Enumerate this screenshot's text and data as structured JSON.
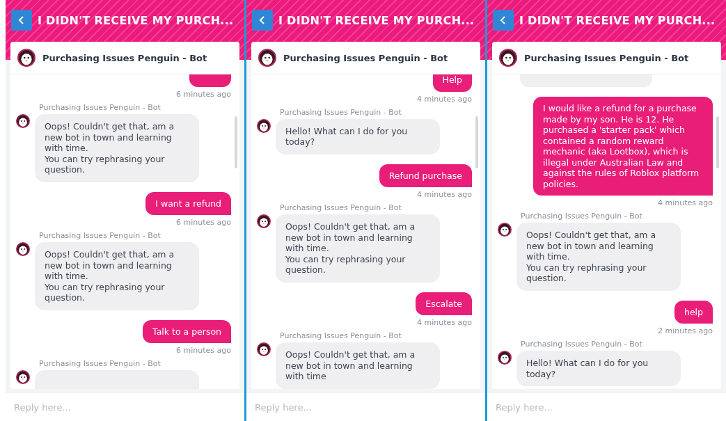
{
  "panels": [
    {
      "title": "I DIDN'T RECEIVE MY PURCH...",
      "bot_name": "Purchasing Issues Penguin - Bot",
      "reply_placeholder": "Reply here...",
      "messages": [
        {
          "kind": "user-cut",
          "time": "6 minutes ago"
        },
        {
          "kind": "bot",
          "sender": "Purchasing Issues Penguin - Bot",
          "text": "Oops! Couldn't get that, am a new bot in town and learning with time.\nYou can try rephrasing your question."
        },
        {
          "kind": "user",
          "text": "I want a refund",
          "time": "6 minutes ago"
        },
        {
          "kind": "bot",
          "sender": "Purchasing Issues Penguin - Bot",
          "text": "Oops! Couldn't get that, am a new bot in town and learning with time.\nYou can try rephrasing your question."
        },
        {
          "kind": "user",
          "text": "Talk to a person",
          "time": "6 minutes ago"
        },
        {
          "kind": "bot",
          "sender": "Purchasing Issues Penguin - Bot"
        }
      ]
    },
    {
      "title": "I DIDN'T RECEIVE MY PURCH...",
      "bot_name": "Purchasing Issues Penguin - Bot",
      "reply_placeholder": "Reply here...",
      "messages": [
        {
          "kind": "user-top",
          "text": "Help",
          "time": "4 minutes ago"
        },
        {
          "kind": "bot",
          "sender": "Purchasing Issues Penguin - Bot",
          "text": "Hello! What can I do for you today?"
        },
        {
          "kind": "user",
          "text": "Refund purchase",
          "time": "4 minutes ago"
        },
        {
          "kind": "bot",
          "sender": "Purchasing Issues Penguin - Bot",
          "text": "Oops! Couldn't get that, am a new bot in town and learning with time.\nYou can try rephrasing your question."
        },
        {
          "kind": "user",
          "text": "Escalate",
          "time": "4 minutes ago"
        },
        {
          "kind": "bot",
          "sender": "Purchasing Issues Penguin - Bot",
          "text": "Oops! Couldn't get that, am a new bot in town and learning with time"
        }
      ]
    },
    {
      "title": "I DIDN'T RECEIVE MY PURCH...",
      "bot_name": "Purchasing Issues Penguin - Bot",
      "reply_placeholder": "Reply here...",
      "messages": [
        {
          "kind": "bot-cut"
        },
        {
          "kind": "user",
          "text": "I would like a refund for a purchase made by my son. He is 12. He purchased a 'starter pack' which contained a random reward mechanic (aka Lootbox), which is illegal under Australian Law and against the rules of Roblox platform policies.",
          "time": "4 minutes ago"
        },
        {
          "kind": "bot",
          "sender": "Purchasing Issues Penguin - Bot",
          "text": "Oops! Couldn't get that, am a new bot in town and learning with time.\nYou can try rephrasing your question."
        },
        {
          "kind": "user",
          "text": "help",
          "time": "2 minutes ago"
        },
        {
          "kind": "bot",
          "sender": "Purchasing Issues Penguin - Bot",
          "text": "Hello! What can I do for you today?"
        }
      ]
    }
  ]
}
